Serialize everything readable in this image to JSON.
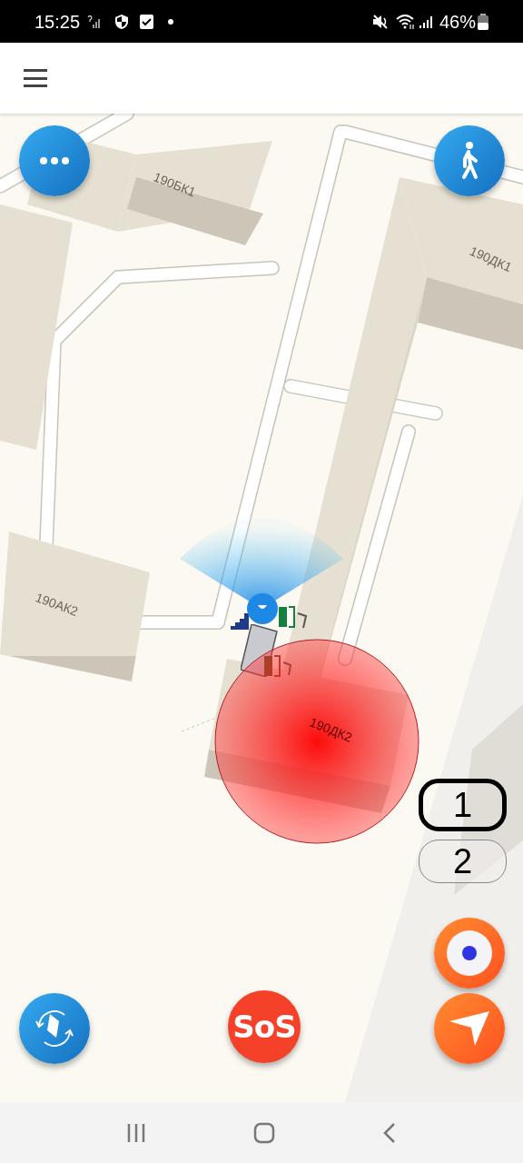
{
  "status_bar": {
    "time": "15:25",
    "battery": "46%"
  },
  "map": {
    "building_labels": [
      "190БК1",
      "190ДК1",
      "190АК2",
      "190ДК2"
    ]
  },
  "floors": [
    {
      "label": "1",
      "selected": true
    },
    {
      "label": "2",
      "selected": false
    }
  ],
  "sos_button": {
    "label": "SoS"
  }
}
